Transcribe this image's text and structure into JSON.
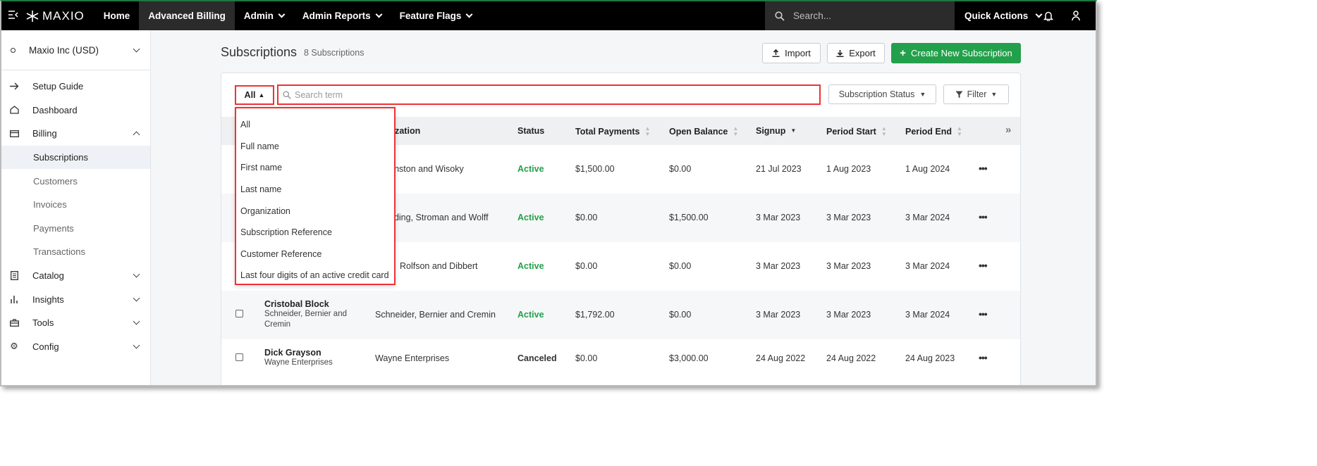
{
  "nav": {
    "brand": "MAXIO",
    "items": [
      {
        "label": "Home"
      },
      {
        "label": "Advanced Billing"
      },
      {
        "label": "Admin"
      },
      {
        "label": "Admin Reports"
      },
      {
        "label": "Feature Flags"
      }
    ],
    "search_placeholder": "Search...",
    "quick_actions": "Quick Actions"
  },
  "sidebar": {
    "account": "Maxio Inc (USD)",
    "items": {
      "setup": "Setup Guide",
      "dashboard": "Dashboard",
      "billing": "Billing",
      "catalog": "Catalog",
      "insights": "Insights",
      "tools": "Tools",
      "config": "Config"
    },
    "billing_sub": {
      "subscriptions": "Subscriptions",
      "customers": "Customers",
      "invoices": "Invoices",
      "payments": "Payments",
      "transactions": "Transactions"
    }
  },
  "page": {
    "title": "Subscriptions",
    "count": "8 Subscriptions",
    "import": "Import",
    "export": "Export",
    "create": "Create New Subscription"
  },
  "filters": {
    "scope": "All",
    "search_placeholder": "Search term",
    "status": "Subscription Status",
    "filter": "Filter"
  },
  "columns": {
    "org": "nization",
    "status": "Status",
    "total": "Total Payments",
    "open": "Open Balance",
    "signup": "Signup",
    "pstart": "Period Start",
    "pend": "Period End"
  },
  "rows": [
    {
      "name": "",
      "org_sub": "",
      "org": ", Johnston and Wisoky",
      "status": "Active",
      "total": "$1,500.00",
      "open": "$0.00",
      "signup": "21 Jul 2023",
      "pstart": "1 Aug 2023",
      "pend": "1 Aug 2024"
    },
    {
      "name": "",
      "org_sub": "",
      "org": "nding, Stroman and Wolff",
      "status": "Active",
      "total": "$0.00",
      "open": "$1,500.00",
      "signup": "3 Mar 2023",
      "pstart": "3 Mar 2023",
      "pend": "3 Mar 2024"
    },
    {
      "name": "",
      "org_sub": "",
      "org": "Rolfson and Dibbert",
      "status": "Active",
      "total": "$0.00",
      "open": "$0.00",
      "signup": "3 Mar 2023",
      "pstart": "3 Mar 2023",
      "pend": "3 Mar 2024"
    },
    {
      "name": "Cristobal Block",
      "org_sub": "Schneider, Bernier and Cremin",
      "org": "Schneider, Bernier and Cremin",
      "status": "Active",
      "total": "$1,792.00",
      "open": "$0.00",
      "signup": "3 Mar 2023",
      "pstart": "3 Mar 2023",
      "pend": "3 Mar 2024"
    },
    {
      "name": "Dick Grayson",
      "org_sub": "Wayne Enterprises",
      "org": "Wayne Enterprises",
      "status": "Canceled",
      "total": "$0.00",
      "open": "$3,000.00",
      "signup": "24 Aug 2022",
      "pstart": "24 Aug 2022",
      "pend": "24 Aug 2023"
    }
  ],
  "dropdown": [
    "All",
    "Full name",
    "First name",
    "Last name",
    "Organization",
    "Subscription Reference",
    "Customer Reference",
    "Last four digits of an active credit card"
  ],
  "colors": {
    "accent": "#23a04b",
    "highlight": "#e33333",
    "nav_bg": "#000000"
  }
}
